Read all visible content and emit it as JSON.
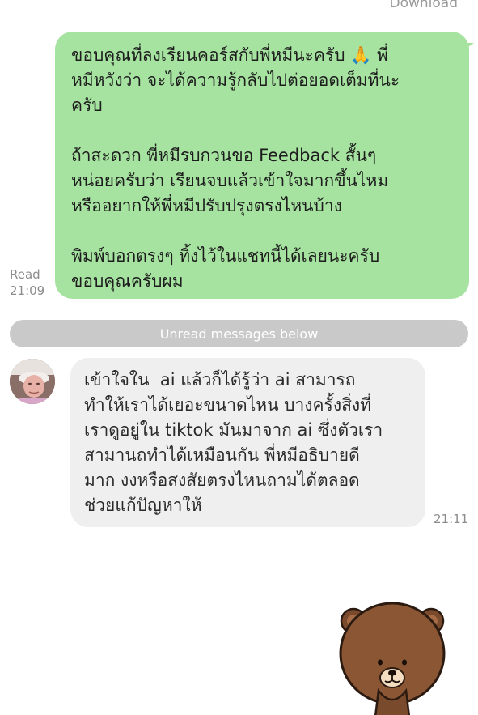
{
  "header": {
    "download_label": "Download"
  },
  "outgoing": {
    "text": "ขอบคุณที่ลงเรียนคอร์สกับพี่หมีนะครับ 🙏 พี่\nหมีหวังว่า จะได้ความรู้กลับไปต่อยอดเต็มที่นะ\nครับ\n\nถ้าสะดวก พี่หมีรบกวนขอ Feedback สั้นๆ\nหน่อยครับว่า เรียนจบแล้วเข้าใจมากขึ้นไหม\nหรืออยากให้พี่หมีปรับปรุงตรงไหนบ้าง\n\nพิมพ์บอกตรงๆ ทิ้งไว้ในแชทนี้ได้เลยนะครับ\nขอบคุณครับผม",
    "read_label": "Read",
    "time": "21:09"
  },
  "divider": {
    "label": "Unread messages below"
  },
  "incoming": {
    "text": "เข้าใจใน  ai แล้วก็ได้รู้ว่า ai สามารถ\nทำให้เราได้เยอะขนาดไหน บางครั้งสิ่งที่\nเราดูอยู่ใน tiktok มันมาจาก ai ซึ่งตัวเรา\nสามานถทำได้เหมือนกัน พี่หมีอธิบายดี\nมาก งงหรือสงสัยตรงไหนถามได้ตลอด\nช่วยแก้ปัญหาให้",
    "time": "21:11",
    "avatar_icon": "user-avatar"
  },
  "sticker": {
    "icon": "brown-bear-sticker"
  },
  "colors": {
    "outgoing_bubble": "#a6e3a0",
    "incoming_bubble": "#efefef",
    "divider": "#c9c9c9",
    "meta_text": "#8c8c8c"
  }
}
